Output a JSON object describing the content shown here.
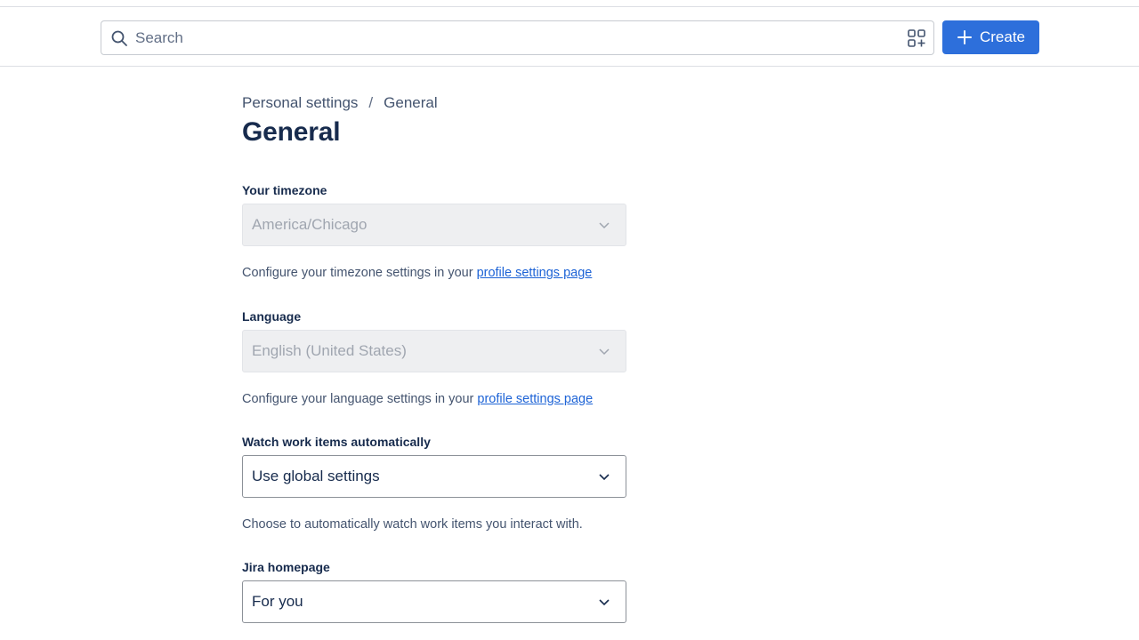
{
  "header": {
    "search_placeholder": "Search",
    "create_label": "Create",
    "accent_color": "#2d6fdb"
  },
  "breadcrumb": {
    "parent": "Personal settings",
    "separator": "/",
    "current": "General"
  },
  "page_title": "General",
  "fields": {
    "timezone": {
      "label": "Your timezone",
      "value": "America/Chicago",
      "help_prefix": "Configure your timezone settings in your",
      "help_link": "profile settings page"
    },
    "language": {
      "label": "Language",
      "value": "English (United States)",
      "help_prefix": "Configure your language settings in your",
      "help_link": "profile settings page"
    },
    "watch": {
      "label": "Watch work items automatically",
      "value": "Use global settings",
      "help": "Choose to automatically watch work items you interact with."
    },
    "homepage": {
      "label": "Jira homepage",
      "value": "For you"
    }
  },
  "icons": {
    "search": "search-icon",
    "apps": "apps-icon",
    "plus": "plus-icon",
    "chevron": "chevron-down-icon"
  }
}
